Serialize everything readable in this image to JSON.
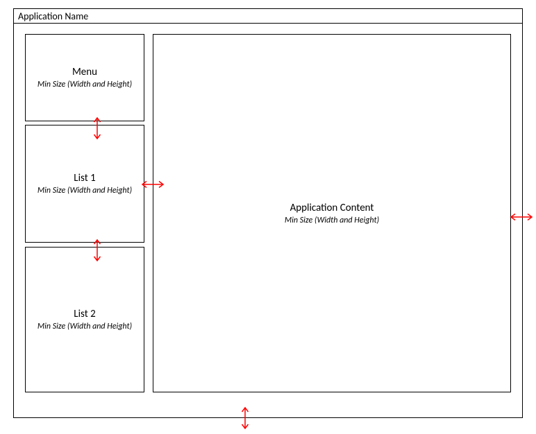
{
  "window": {
    "title": "Application Name"
  },
  "panels": {
    "menu": {
      "title": "Menu",
      "subtitle": "Min Size (Width and Height)"
    },
    "list1": {
      "title": "List 1",
      "subtitle": "Min Size (Width and Height)"
    },
    "list2": {
      "title": "List 2",
      "subtitle": "Min Size (Width and Height)"
    },
    "content": {
      "title": "Application Content",
      "subtitle": "Min Size (Width and Height)"
    }
  }
}
